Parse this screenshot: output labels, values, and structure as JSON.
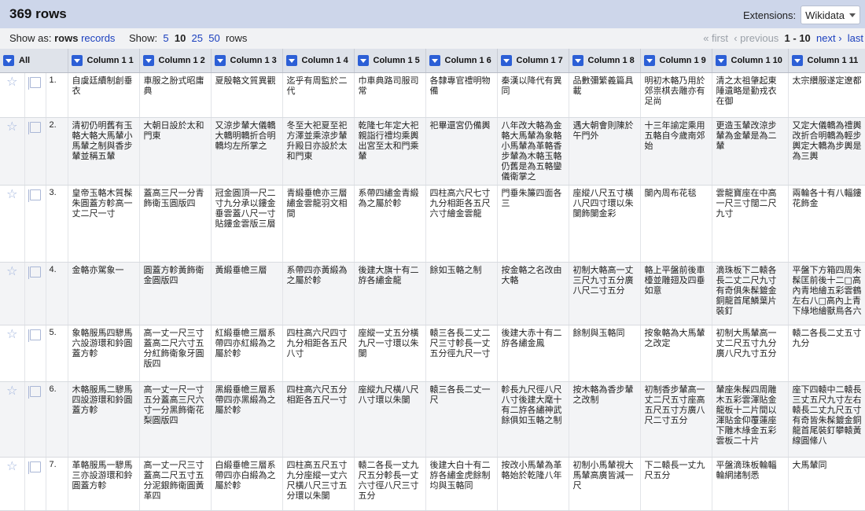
{
  "header": {
    "rows_count": "369 rows",
    "extensions_label": "Extensions:",
    "extensions_value": "Wikidata"
  },
  "toolbar": {
    "show_as_label": "Show as:",
    "show_as_rows": "rows",
    "show_as_records": "records",
    "show_label": "Show:",
    "show_options": [
      "5",
      "10",
      "25",
      "50"
    ],
    "show_selected": "10",
    "show_suffix": "rows",
    "pager": {
      "first": "« first",
      "previous": "‹ previous",
      "range": "1 - 10",
      "next": "next ›",
      "last": "last"
    }
  },
  "table": {
    "all_label": "All",
    "columns": [
      "Column 1 1",
      "Column 1 2",
      "Column 1 3",
      "Column 1 4",
      "Column 1 5",
      "Column 1 6",
      "Column 1 7",
      "Column 1 8",
      "Column 1 9",
      "Column 1 10",
      "Column 1 11"
    ],
    "rows": [
      {
        "index": "1.",
        "cells": [
          "自虞廷續制創垂衣",
          "車服之朌式昭庸典",
          "夏殷輅文質異觀",
          "迄乎有周監於二代",
          "巾車典路司服司常",
          "各隸專官禮明物備",
          "秦漢以降代有異同",
          "品數彌繁義篇具載",
          "明初木輅乃用於郊祟棋去雕亦有足尚",
          "清之太祖肇起東陲遺略是勤戎衣在御",
          "太宗纘服遂定遼都"
        ]
      },
      {
        "index": "2.",
        "cells": [
          "清初仍明舊有玉輅大輅大馬輦小馬輦之制與香步輦並稱五輦",
          "大朝日設於太和門東",
          "又涼步輦大儀轎大轎明轎折合明轎均左所掌之",
          "冬至大祀夏至祀方澤並乘涼步輦升殿日亦設於太和門東",
          "乾隆七年定大祀親詣行禮均乘輿出宮至太和門乘輦",
          "祀畢還宮仍備輿",
          "八年改大輅為金輅大馬輦為象輅小馬輦為革輅香步輦為木輅玉輅仍舊是為五輅鑾儀衛掌之",
          "遇大朝會則陳於午門外",
          "十三年諭定乘用五輅自今歲南郊始",
          "更造玉輦改涼步輦為金輦是為二輦",
          "又定大儀轎為禮輿改折合明轎為輕步輿定大轎為步輿是為三輿"
        ]
      },
      {
        "index": "3.",
        "cells": [
          "皇帝玉輅木質髹朱圓蓋方軫高一丈二尺一寸",
          "蓋高三尺一分青飾衛玉圓版四",
          "冠金圓頂一尺二寸九分承以鏤金垂雲蓋八尺一寸貼鏤金雲版三層",
          "青緞垂幨亦三層繡金雲龍羽文相間",
          "系帶四繡金青緞為之屬於軫",
          "四柱高六尺七寸九分相距各五尺六寸繪金雲龍",
          "門垂朱簾四面各三",
          "座縱八尺五寸橫八尺四寸環以朱闌飾闌金彩",
          "闌內周布花毯",
          "雲龍寶座在中高一尺三寸闊二尺九寸",
          "兩輪各十有八輻鏤花飾金"
        ]
      },
      {
        "index": "4.",
        "cells": [
          "金輅亦駕象一",
          "圓蓋方軫黃飾衛金圓版四",
          "黃緞垂幨三層",
          "系帶四亦黃緞為之屬於軫",
          "後建大旗十有二斿各繡金龍",
          "餘如玉輅之制",
          "按金輅之名改由大輅",
          "初制大輅高一丈三尺九寸五分廣八尺二寸五分",
          "輅上平盤前後車檯並雕翅及四垂如意",
          "滴珠板下二轅各長二丈二尺九寸有奇俱朱髹鍍金銅龍首尾鱗葉片裝釘",
          "平盤下方箱四周朱髹匡前後十二□高內青地繪五彩雲鶴左右八□高內上青下綠地繪獸鳥各六"
        ]
      },
      {
        "index": "5.",
        "cells": [
          "象輅服馬四驂馬六設游環和鈴圓蓋方軫",
          "高一丈一尺三寸蓋高二尺六寸五分紅飾衛象牙圓版四",
          "紅緞垂幨三層系帶四亦紅緞為之屬於軫",
          "四柱高六尺四寸九分相距各五尺八寸",
          "座縱一丈五分橫九尺一寸環以朱闌",
          "轅三各長二丈二尺三寸軫長一丈五分徑九尺一寸",
          "後建大赤十有二斿各繡金鳳",
          "餘制與玉輅同",
          "按象輅為大馬輦之改定",
          "初制大馬輦高一丈二尺五寸九分廣八尺九寸五分",
          "轅二各長二丈五寸九分"
        ]
      },
      {
        "index": "6.",
        "cells": [
          "木輅服馬二驂馬四設游環和鈴圓蓋方軫",
          "高一丈一尺一寸五分蓋高三尺六寸一分黑飾衛花梨圓版四",
          "黑緞垂幨三層系帶四亦黑緞為之屬於軫",
          "四柱高六尺五分相距各五尺一寸",
          "座縱九尺橫八尺八寸環以朱闌",
          "轅三各長二丈一尺",
          "軫長九尺徑八尺八寸後建大麾十有二斿各繡神武餘俱如玉輅之制",
          "按木輅為香步輦之改制",
          "初制香步輦高一丈二尺五寸座高五尺五寸方廣八尺二寸五分",
          "輦座朱髹四周雕木五彩雲渾貼金龍板十二片間以渾貼金仰覆蓮座下雕木綠金五彩雲板二十片",
          "座下四轅中二轅長三丈五尺九寸左右轅長二丈九尺五寸有奇皆朱髹鍍金銅龍首尾裝釘攀轅黃線圓絛八"
        ]
      },
      {
        "index": "7.",
        "cells": [
          "革輅服馬一驂馬三亦設游環和鈴圓蓋方軫",
          "高一丈一尺三寸蓋高二尺五寸五分泥銀飾衛圓黃革四",
          "白緞垂幨三層系帶四亦白緞為之屬於軫",
          "四柱高五尺五寸九分座縱一丈六尺橫八尺三寸五分環以朱闌",
          "轅二各長一丈九尺五分軫長一丈六寸徑八尺三寸五分",
          "後建大白十有二斿各繡金虎餘制均與玉輅同",
          "按改小馬輦為革輅始於乾隆八年",
          "初制小馬輦視大馬輦高廣皆減一尺",
          "下二轅長一丈九尺五分",
          "平盤滴珠板輪輻輪網諸制悉",
          "大馬輦同"
        ]
      }
    ]
  },
  "icons": {
    "star": "star-icon",
    "flag": "flag-icon",
    "column_menu": "chevron-down-icon"
  },
  "colors": {
    "header_bg": "#cdd6ea",
    "link": "#1a3fbe",
    "menu_button": "#2c5fd6"
  }
}
